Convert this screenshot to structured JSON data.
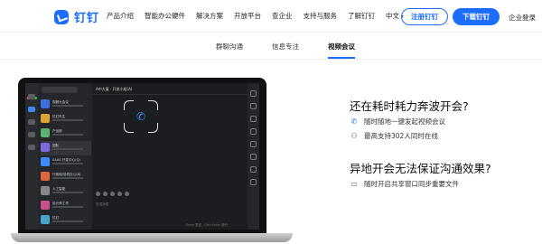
{
  "nav": {
    "brand": "钉钉",
    "items": [
      "产品介绍",
      "智能办公硬件",
      "解决方案",
      "开放平台",
      "查企业",
      "支持与服务",
      "了解钉钉",
      "中文"
    ],
    "register_label": "注册钉钉",
    "download_label": "下载钉钉",
    "login_label": "企业登录"
  },
  "subtabs": {
    "items": [
      "群聊沟通",
      "信息专注",
      "视频会议"
    ],
    "active_index": 2
  },
  "mock_screen": {
    "chat_header": "A中大厦 · 开发小组(A)",
    "contacts": [
      "视频大会议",
      "钉钉先生",
      "产品部",
      "团队",
      "SAAS 开发中心(Q)",
      "行政组/协同办公(6)",
      "人工智能",
      "设计师工作",
      "钉钉",
      "研发组(A)",
      "张三"
    ],
    "input_hint": "发送消息",
    "send_hint": "Enter 发送，Ctrl+Enter 换行"
  },
  "features": [
    {
      "title": "还在耗时耗力奔波开会?",
      "points": [
        {
          "icon": "phone-icon",
          "text": "随时随地一键发起视频会议"
        },
        {
          "icon": "people-icon",
          "text": "最高支持302人同时在线"
        }
      ]
    },
    {
      "title": "异地开会无法保证沟通效果?",
      "points": [
        {
          "icon": "monitor-icon",
          "text": "随时开启共享窗口同步重要文件"
        }
      ]
    }
  ],
  "colors": {
    "accent": "#1a6dff",
    "dark_ui": "#1e1f22"
  }
}
